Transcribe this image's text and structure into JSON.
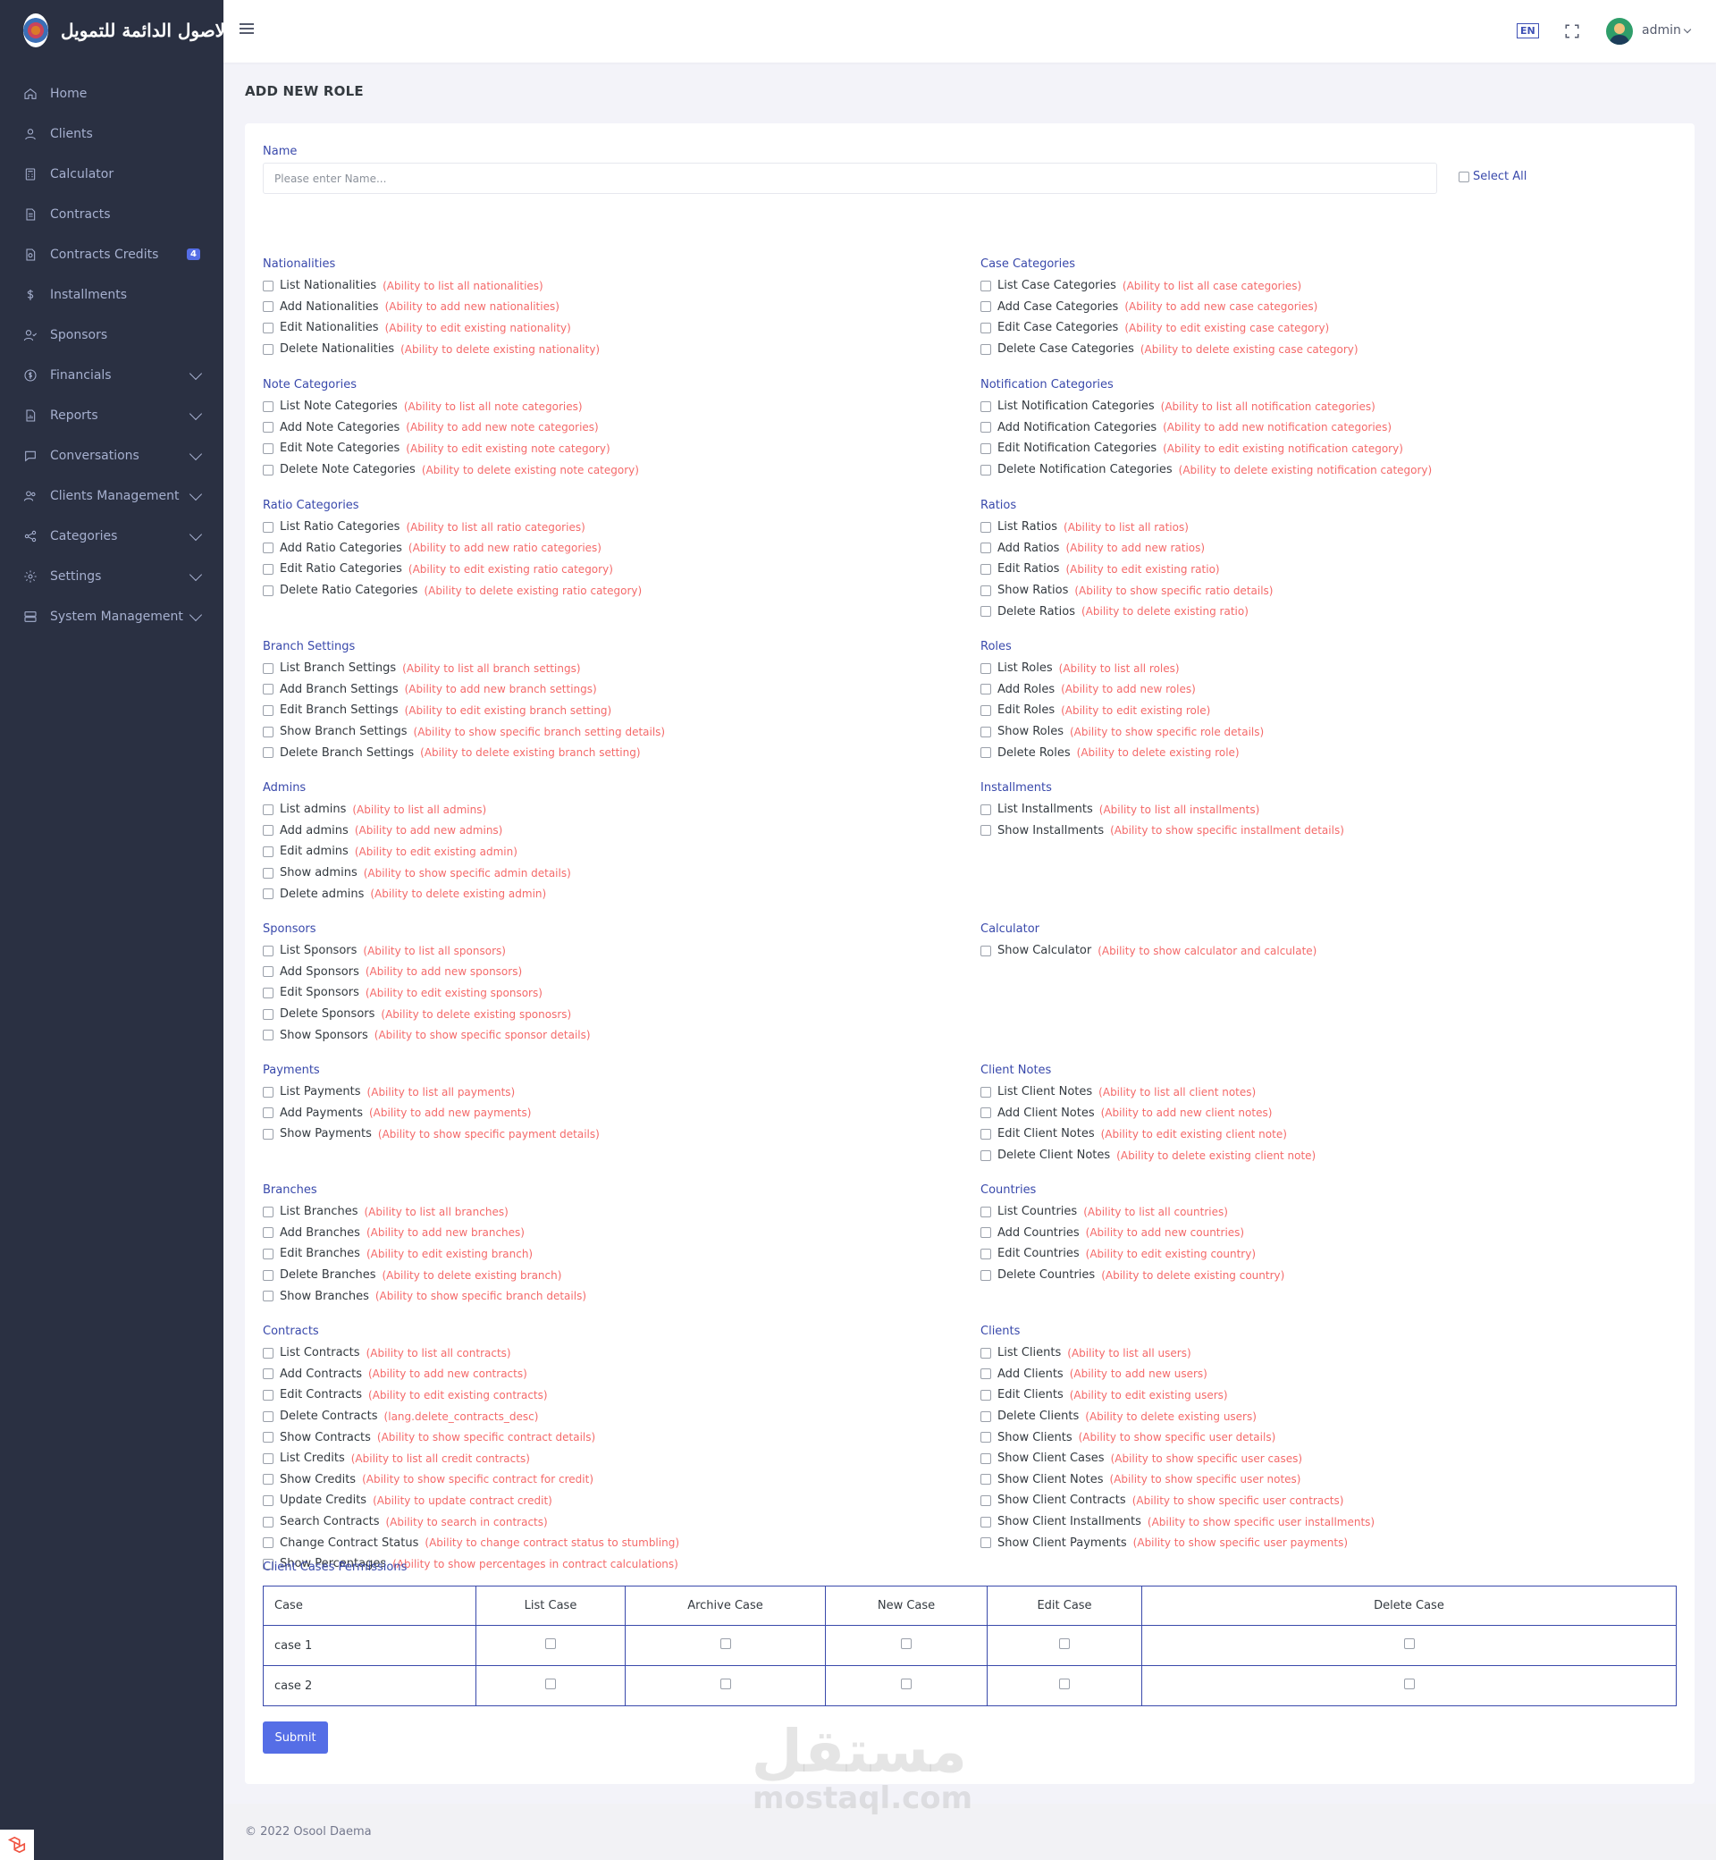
{
  "brand": {
    "name": "الاصول الدائمة للتمويل"
  },
  "sidebar": {
    "items": [
      {
        "label": "Home",
        "icon": "home-icon",
        "chevron": false
      },
      {
        "label": "Clients",
        "icon": "user-icon",
        "chevron": false
      },
      {
        "label": "Calculator",
        "icon": "calculator-icon",
        "chevron": false
      },
      {
        "label": "Contracts",
        "icon": "file-text-icon",
        "chevron": false
      },
      {
        "label": "Contracts Credits",
        "icon": "file-search-icon",
        "chevron": false,
        "badge": "4"
      },
      {
        "label": "Installments",
        "icon": "dollar-icon",
        "chevron": false
      },
      {
        "label": "Sponsors",
        "icon": "user-check-icon",
        "chevron": false
      },
      {
        "label": "Financials",
        "icon": "coin-icon",
        "chevron": true
      },
      {
        "label": "Reports",
        "icon": "report-icon",
        "chevron": true
      },
      {
        "label": "Conversations",
        "icon": "chat-icon",
        "chevron": true
      },
      {
        "label": "Clients Management",
        "icon": "users-icon",
        "chevron": true
      },
      {
        "label": "Categories",
        "icon": "share-icon",
        "chevron": true
      },
      {
        "label": "Settings",
        "icon": "gear-icon",
        "chevron": true
      },
      {
        "label": "System Management",
        "icon": "server-icon",
        "chevron": true
      }
    ]
  },
  "topbar": {
    "lang": "EN",
    "user": "admin"
  },
  "page": {
    "title": "ADD NEW ROLE"
  },
  "form": {
    "name_label": "Name",
    "name_placeholder": "Please enter Name...",
    "select_all": "Select All",
    "groups": [
      {
        "col": 0,
        "title": "Nationalities",
        "perms": [
          [
            "List Nationalities",
            "(Ability to list all nationalities)"
          ],
          [
            "Add Nationalities",
            "(Ability to add new nationalities)"
          ],
          [
            "Edit Nationalities",
            "(Ability to edit existing nationality)"
          ],
          [
            "Delete Nationalities",
            "(Ability to delete existing nationality)"
          ]
        ]
      },
      {
        "col": 1,
        "title": "Case Categories",
        "perms": [
          [
            "List Case Categories",
            "(Ability to list all case categories)"
          ],
          [
            "Add Case Categories",
            "(Ability to add new case categories)"
          ],
          [
            "Edit Case Categories",
            "(Ability to edit existing case category)"
          ],
          [
            "Delete Case Categories",
            "(Ability to delete existing case category)"
          ]
        ]
      },
      {
        "col": 0,
        "title": "Note Categories",
        "perms": [
          [
            "List Note Categories",
            "(Ability to list all note categories)"
          ],
          [
            "Add Note Categories",
            "(Ability to add new note categories)"
          ],
          [
            "Edit Note Categories",
            "(Ability to edit existing note category)"
          ],
          [
            "Delete Note Categories",
            "(Ability to delete existing note category)"
          ]
        ]
      },
      {
        "col": 1,
        "title": "Notification Categories",
        "perms": [
          [
            "List Notification Categories",
            "(Ability to list all notification categories)"
          ],
          [
            "Add Notification Categories",
            "(Ability to add new notification categories)"
          ],
          [
            "Edit Notification Categories",
            "(Ability to edit existing notification category)"
          ],
          [
            "Delete Notification Categories",
            "(Ability to delete existing notification category)"
          ]
        ]
      },
      {
        "col": 0,
        "title": "Ratio Categories",
        "perms": [
          [
            "List Ratio Categories",
            "(Ability to list all ratio categories)"
          ],
          [
            "Add Ratio Categories",
            "(Ability to add new ratio categories)"
          ],
          [
            "Edit Ratio Categories",
            "(Ability to edit existing ratio category)"
          ],
          [
            "Delete Ratio Categories",
            "(Ability to delete existing ratio category)"
          ]
        ]
      },
      {
        "col": 1,
        "title": "Ratios",
        "perms": [
          [
            "List Ratios",
            "(Ability to list all ratios)"
          ],
          [
            "Add Ratios",
            "(Ability to add new ratios)"
          ],
          [
            "Edit Ratios",
            "(Ability to edit existing ratio)"
          ],
          [
            "Show Ratios",
            "(Ability to show specific ratio details)"
          ],
          [
            "Delete Ratios",
            "(Ability to delete existing ratio)"
          ]
        ]
      },
      {
        "col": 0,
        "title": "Branch Settings",
        "perms": [
          [
            "List Branch Settings",
            "(Ability to list all branch settings)"
          ],
          [
            "Add Branch Settings",
            "(Ability to add new branch settings)"
          ],
          [
            "Edit Branch Settings",
            "(Ability to edit existing branch setting)"
          ],
          [
            "Show Branch Settings",
            "(Ability to show specific branch setting details)"
          ],
          [
            "Delete Branch Settings",
            "(Ability to delete existing branch setting)"
          ]
        ]
      },
      {
        "col": 1,
        "title": "Roles",
        "perms": [
          [
            "List Roles",
            "(Ability to list all roles)"
          ],
          [
            "Add Roles",
            "(Ability to add new roles)"
          ],
          [
            "Edit Roles",
            "(Ability to edit existing role)"
          ],
          [
            "Show Roles",
            "(Ability to show specific role details)"
          ],
          [
            "Delete Roles",
            "(Ability to delete existing role)"
          ]
        ]
      },
      {
        "col": 0,
        "title": "Admins",
        "perms": [
          [
            "List admins",
            "(Ability to list all admins)"
          ],
          [
            "Add admins",
            "(Ability to add new admins)"
          ],
          [
            "Edit admins",
            "(Ability to edit existing admin)"
          ],
          [
            "Show admins",
            "(Ability to show specific admin details)"
          ],
          [
            "Delete admins",
            "(Ability to delete existing admin)"
          ]
        ]
      },
      {
        "col": 1,
        "title": "Installments",
        "perms": [
          [
            "List Installments",
            "(Ability to list all installments)"
          ],
          [
            "Show Installments",
            "(Ability to show specific installment details)"
          ]
        ]
      },
      {
        "col": 0,
        "title": "Sponsors",
        "perms": [
          [
            "List Sponsors",
            "(Ability to list all sponsors)"
          ],
          [
            "Add Sponsors",
            "(Ability to add new sponsors)"
          ],
          [
            "Edit Sponsors",
            "(Ability to edit existing sponsors)"
          ],
          [
            "Delete Sponsors",
            "(Ability to delete existing sponosrs)"
          ],
          [
            "Show Sponsors",
            "(Ability to show specific sponsor details)"
          ]
        ]
      },
      {
        "col": 1,
        "title": "Calculator",
        "perms": [
          [
            "Show Calculator",
            "(Ability to show calculator and calculate)"
          ]
        ]
      },
      {
        "col": 0,
        "title": "Payments",
        "perms": [
          [
            "List Payments",
            "(Ability to list all payments)"
          ],
          [
            "Add Payments",
            "(Ability to add new payments)"
          ],
          [
            "Show Payments",
            "(Ability to show specific payment details)"
          ]
        ]
      },
      {
        "col": 1,
        "title": "Client Notes",
        "perms": [
          [
            "List Client Notes",
            "(Ability to list all client notes)"
          ],
          [
            "Add Client Notes",
            "(Ability to add new client notes)"
          ],
          [
            "Edit Client Notes",
            "(Ability to edit existing client note)"
          ],
          [
            "Delete Client Notes",
            "(Ability to delete existing client note)"
          ]
        ]
      },
      {
        "col": 0,
        "title": "Branches",
        "perms": [
          [
            "List Branches",
            "(Ability to list all branches)"
          ],
          [
            "Add Branches",
            "(Ability to add new branches)"
          ],
          [
            "Edit Branches",
            "(Ability to edit existing branch)"
          ],
          [
            "Delete Branches",
            "(Ability to delete existing branch)"
          ],
          [
            "Show Branches",
            "(Ability to show specific branch details)"
          ]
        ]
      },
      {
        "col": 1,
        "title": "Countries",
        "perms": [
          [
            "List Countries",
            "(Ability to list all countries)"
          ],
          [
            "Add Countries",
            "(Ability to add new countries)"
          ],
          [
            "Edit Countries",
            "(Ability to edit existing country)"
          ],
          [
            "Delete Countries",
            "(Ability to delete existing country)"
          ]
        ]
      },
      {
        "col": 0,
        "title": "Contracts",
        "perms": [
          [
            "List Contracts",
            "(Ability to list all contracts)"
          ],
          [
            "Add Contracts",
            "(Ability to add new contracts)"
          ],
          [
            "Edit Contracts",
            "(Ability to edit existing contracts)"
          ],
          [
            "Delete Contracts",
            "(lang.delete_contracts_desc)"
          ],
          [
            "Show Contracts",
            "(Ability to show specific contract details)"
          ],
          [
            "List Credits",
            "(Ability to list all credit contracts)"
          ],
          [
            "Show Credits",
            "(Ability to show specific contract for credit)"
          ],
          [
            "Update Credits",
            "(Ability to update contract credit)"
          ],
          [
            "Search Contracts",
            "(Ability to search in contracts)"
          ],
          [
            "Change Contract Status",
            "(Ability to change contract status to stumbling)"
          ],
          [
            "Show Percentages",
            "(Ability to show percentages in contract calculations)"
          ]
        ]
      },
      {
        "col": 1,
        "title": "Clients",
        "perms": [
          [
            "List Clients",
            "(Ability to list all users)"
          ],
          [
            "Add Clients",
            "(Ability to add new users)"
          ],
          [
            "Edit Clients",
            "(Ability to edit existing users)"
          ],
          [
            "Delete Clients",
            "(Ability to delete existing users)"
          ],
          [
            "Show Clients",
            "(Ability to show specific user details)"
          ],
          [
            "Show Client Cases",
            "(Ability to show specific user cases)"
          ],
          [
            "Show Client Notes",
            "(Ability to show specific user notes)"
          ],
          [
            "Show Client Contracts",
            "(Ability to show specific user contracts)"
          ],
          [
            "Show Client Installments",
            "(Ability to show specific user installments)"
          ],
          [
            "Show Client Payments",
            "(Ability to show specific user payments)"
          ]
        ]
      }
    ],
    "cases": {
      "title": "Client Cases Permissions",
      "headers": [
        "Case",
        "List Case",
        "Archive Case",
        "New Case",
        "Edit Case",
        "Delete Case"
      ],
      "rows": [
        "case 1",
        "case 2"
      ]
    },
    "submit": "Submit"
  },
  "footer": {
    "text": "© 2022 Osool Daema"
  },
  "watermark": {
    "ar": "مستقل",
    "en": "mostaql.com"
  }
}
